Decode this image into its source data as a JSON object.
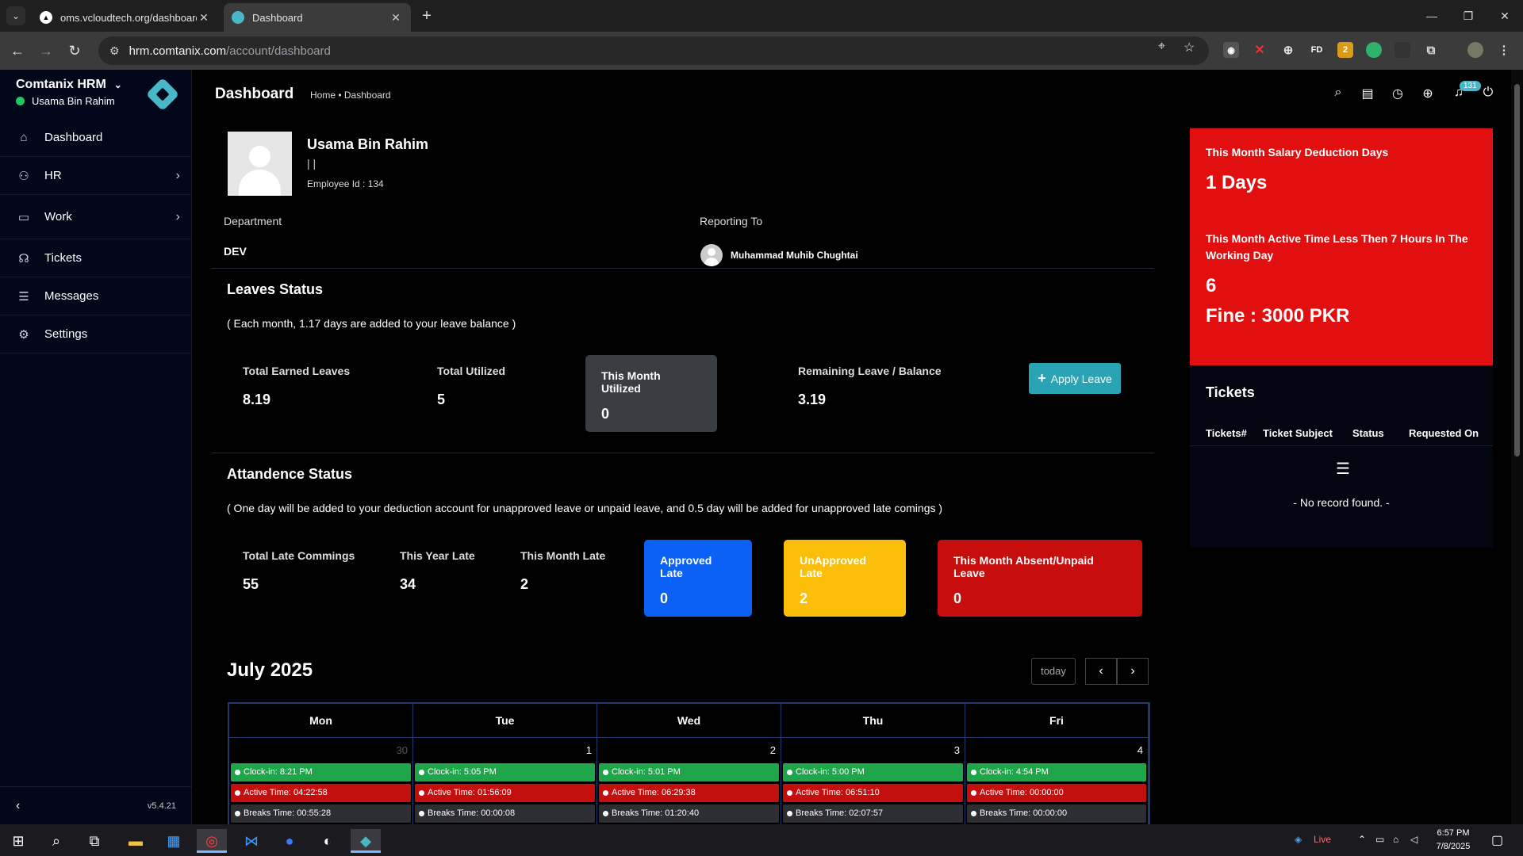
{
  "browser": {
    "tabs": [
      {
        "label": "oms.vcloudtech.org/dashboard",
        "icon": "vercel-icon"
      },
      {
        "label": "Dashboard",
        "icon": "comtanix-icon"
      }
    ],
    "url_host": "hrm.comtanix.com",
    "url_path": "/account/dashboard",
    "extensions": {
      "fd": "FD",
      "badge": "2"
    }
  },
  "sidebar": {
    "app_name": "Comtanix HRM",
    "user": "Usama Bin Rahim",
    "items": [
      {
        "label": "Dashboard",
        "icon": "home-icon"
      },
      {
        "label": "HR",
        "icon": "users-icon"
      },
      {
        "label": "Work",
        "icon": "briefcase-icon"
      },
      {
        "label": "Tickets",
        "icon": "headset-icon"
      },
      {
        "label": "Messages",
        "icon": "chat-icon"
      },
      {
        "label": "Settings",
        "icon": "gear-icon"
      }
    ],
    "version": "v5.4.21"
  },
  "topbar": {
    "title": "Dashboard",
    "breadcrumb": "Home • Dashboard",
    "notification_count": "131"
  },
  "profile": {
    "name": "Usama Bin Rahim",
    "separator": "| |",
    "employee_id": "Employee Id : 134",
    "department_label": "Department",
    "department": "DEV",
    "reporting_label": "Reporting To",
    "reporting_to": "Muhammad Muhib Chughtai"
  },
  "leaves": {
    "title": "Leaves Status",
    "note": "( Each month, 1.17 days are added to your leave balance )",
    "total_earned_label": "Total Earned Leaves",
    "total_earned": "8.19",
    "total_utilized_label": "Total Utilized",
    "total_utilized": "5",
    "month_utilized_label": "This Month Utilized",
    "month_utilized": "0",
    "remaining_label": "Remaining Leave / Balance",
    "remaining": "3.19",
    "apply_button": "Apply Leave"
  },
  "attendance": {
    "title": "Attandence Status",
    "note": "( One day will be added to your deduction account for unapproved leave or unpaid leave, and 0.5 day will be added for unapproved late comings )",
    "total_late_label": "Total Late Commings",
    "total_late": "55",
    "year_late_label": "This Year Late",
    "year_late": "34",
    "month_late_label": "This Month Late",
    "month_late": "2",
    "approved_late_label": "Approved Late",
    "approved_late": "0",
    "unapproved_late_label": "UnApproved Late",
    "unapproved_late": "2",
    "absent_label": "This Month Absent/Unpaid Leave",
    "absent": "0",
    "colors": {
      "approved": "#0b61f5",
      "unapproved": "#fbbf0a",
      "absent": "#c80d0d"
    }
  },
  "calendar": {
    "title": "July 2025",
    "today_button": "today",
    "days": [
      {
        "name": "Mon",
        "date": "30",
        "clock_in": "Clock-in: 8:21 PM",
        "active": "Active Time: 04:22:58",
        "breaks": "Breaks Time: 00:55:28"
      },
      {
        "name": "Tue",
        "date": "1",
        "clock_in": "Clock-in: 5:05 PM",
        "active": "Active Time: 01:56:09",
        "breaks": "Breaks Time: 00:00:08"
      },
      {
        "name": "Wed",
        "date": "2",
        "clock_in": "Clock-in: 5:01 PM",
        "active": "Active Time: 06:29:38",
        "breaks": "Breaks Time: 01:20:40"
      },
      {
        "name": "Thu",
        "date": "3",
        "clock_in": "Clock-in: 5:00 PM",
        "active": "Active Time: 06:51:10",
        "breaks": "Breaks Time: 02:07:57"
      },
      {
        "name": "Fri",
        "date": "4",
        "clock_in": "Clock-in: 4:54 PM",
        "active": "Active Time: 00:00:00",
        "breaks": "Breaks Time: 00:00:00"
      }
    ]
  },
  "salary_card": {
    "deduction_label": "This Month Salary Deduction Days",
    "deduction_value": "1 Days",
    "active_label": "This Month Active Time Less Then 7 Hours In The Working Day",
    "active_value": "6",
    "fine": "Fine : 3000 PKR",
    "color": "#e10f0f"
  },
  "tickets": {
    "title": "Tickets",
    "columns": [
      "Tickets#",
      "Ticket Subject",
      "Status",
      "Requested On"
    ],
    "empty": "- No record found. -"
  },
  "taskbar": {
    "weather": "Live",
    "time": "6:57 PM",
    "date": "7/8/2025"
  }
}
